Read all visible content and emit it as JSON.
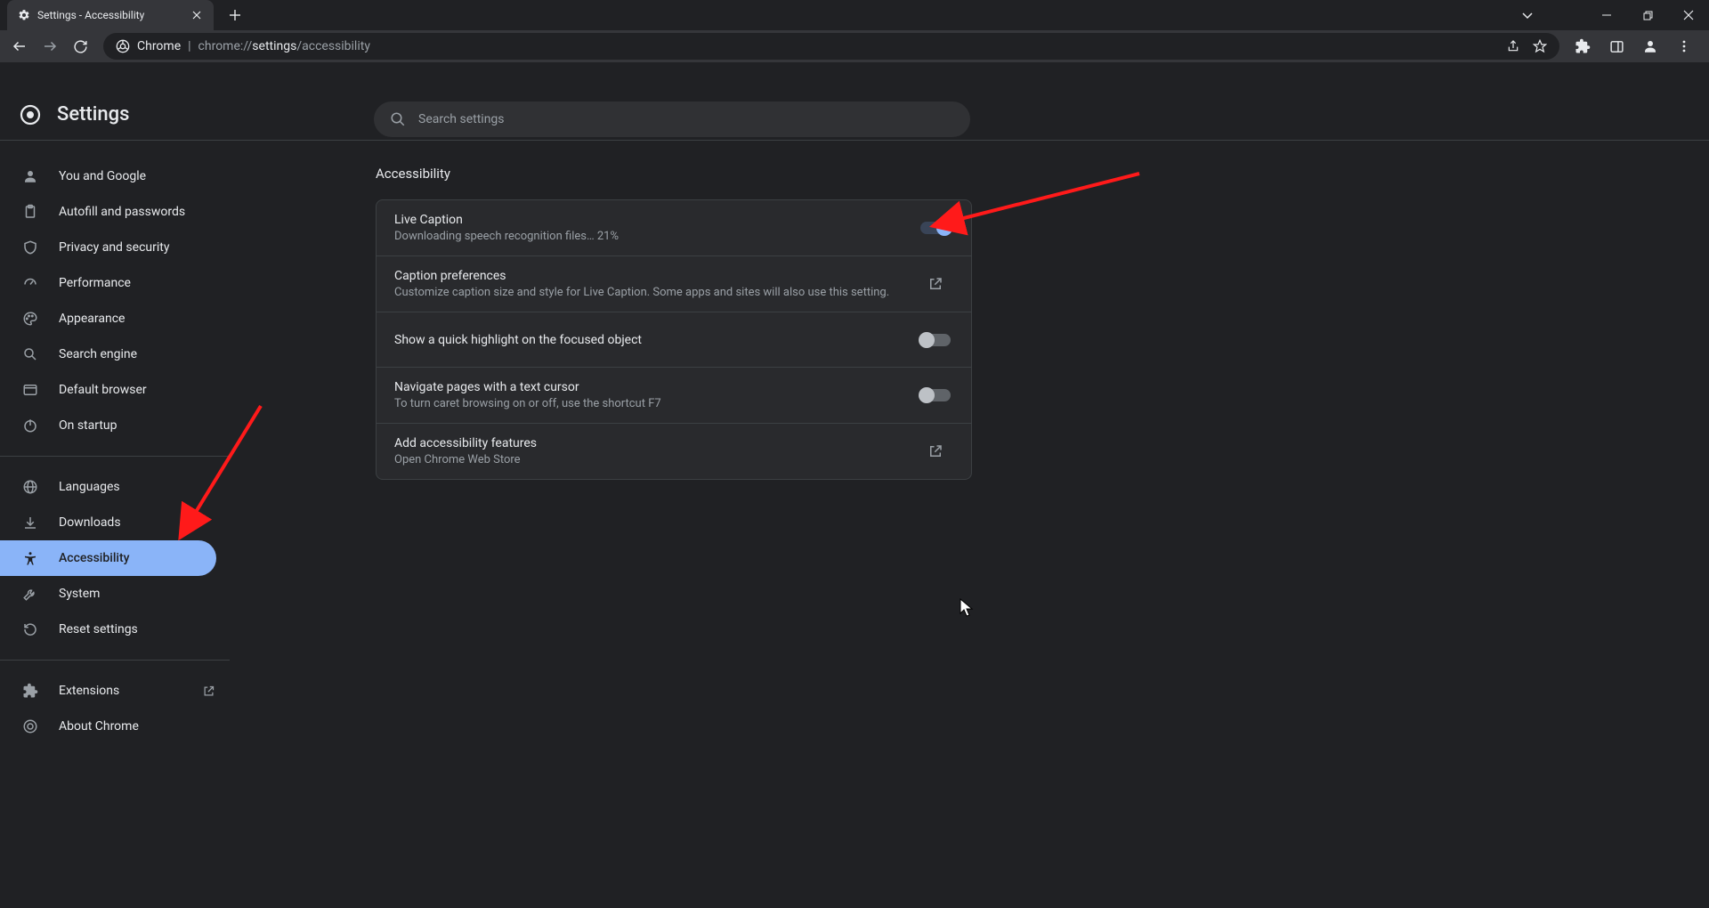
{
  "browser": {
    "tab_title": "Settings - Accessibility",
    "url_prefix": "chrome://",
    "url_mid": "settings",
    "url_suffix": "/accessibility",
    "chrome_label": "Chrome"
  },
  "header": {
    "title": "Settings",
    "search_placeholder": "Search settings"
  },
  "sidebar": {
    "g1": [
      {
        "label": "You and Google"
      },
      {
        "label": "Autofill and passwords"
      },
      {
        "label": "Privacy and security"
      },
      {
        "label": "Performance"
      },
      {
        "label": "Appearance"
      },
      {
        "label": "Search engine"
      },
      {
        "label": "Default browser"
      },
      {
        "label": "On startup"
      }
    ],
    "g2": [
      {
        "label": "Languages"
      },
      {
        "label": "Downloads"
      },
      {
        "label": "Accessibility"
      },
      {
        "label": "System"
      },
      {
        "label": "Reset settings"
      }
    ],
    "g3": [
      {
        "label": "Extensions"
      },
      {
        "label": "About Chrome"
      }
    ]
  },
  "section": {
    "title": "Accessibility",
    "rows": {
      "live_caption": {
        "title": "Live Caption",
        "sub": "Downloading speech recognition files… 21%"
      },
      "caption_pref": {
        "title": "Caption preferences",
        "sub": "Customize caption size and style for Live Caption. Some apps and sites will also use this setting."
      },
      "highlight": {
        "title": "Show a quick highlight on the focused object"
      },
      "caret": {
        "title": "Navigate pages with a text cursor",
        "sub": "To turn caret browsing on or off, use the shortcut F7"
      },
      "add_feat": {
        "title": "Add accessibility features",
        "sub": "Open Chrome Web Store"
      }
    }
  }
}
